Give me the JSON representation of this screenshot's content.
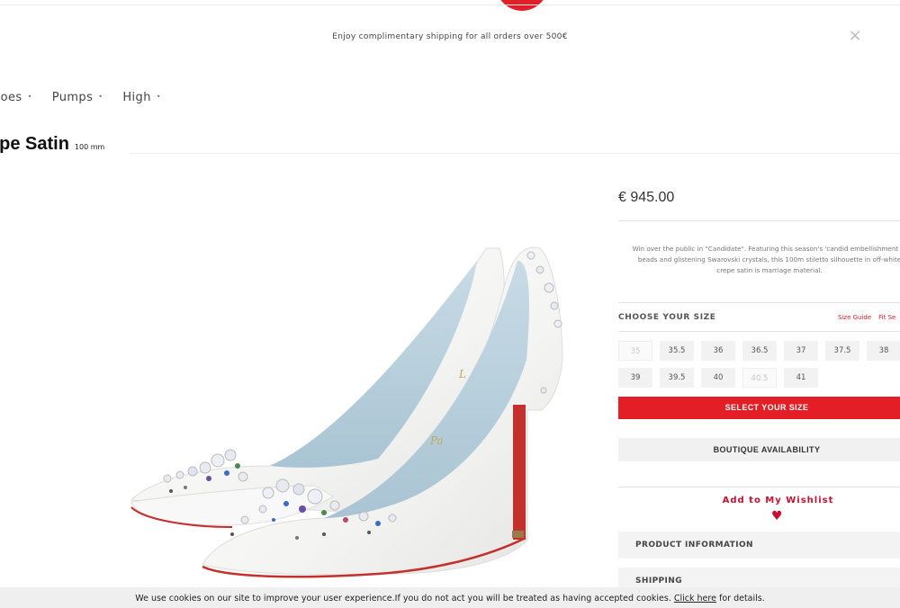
{
  "header": {
    "promo_text": "Enjoy complimentary shipping for all orders over 500€",
    "close_glyph": "×",
    "brand_color": "#e41e26"
  },
  "breadcrumb": [
    "hoes",
    "Pumps",
    "High"
  ],
  "product": {
    "name": "epe Satin",
    "heel_height": "100 mm",
    "price": "€ 945.00",
    "description": "Win over the public in \"Candidate\". Featuring this season's 'candid embellishment of beads and glistening Swarovski crystals, this 100m stiletto silhouette in off-white crepe satin is marriage material."
  },
  "size_selector": {
    "title": "CHOOSE YOUR SIZE",
    "size_guide": "Size Guide",
    "fit_link": "Fit Se",
    "sizes": [
      {
        "label": "35",
        "available": false
      },
      {
        "label": "35.5",
        "available": true
      },
      {
        "label": "36",
        "available": true
      },
      {
        "label": "36.5",
        "available": true
      },
      {
        "label": "37",
        "available": true
      },
      {
        "label": "37.5",
        "available": true
      },
      {
        "label": "38",
        "available": true
      },
      {
        "label": "39",
        "available": true
      },
      {
        "label": "39.5",
        "available": true
      },
      {
        "label": "40",
        "available": true
      },
      {
        "label": "40.5",
        "available": false
      },
      {
        "label": "41",
        "available": true
      }
    ]
  },
  "actions": {
    "select_size": "SELECT YOUR SIZE",
    "boutique": "BOUTIQUE AVAILABILITY",
    "wishlist": "Add to My Wishlist",
    "heart": "♥"
  },
  "accordion": [
    "PRODUCT INFORMATION",
    "SHIPPING"
  ],
  "cookie": {
    "text": "We use cookies on our site to improve your user experience.If you do not act you will be treated as having accepted cookies.",
    "link": "Click here",
    "suffix": "for details."
  }
}
